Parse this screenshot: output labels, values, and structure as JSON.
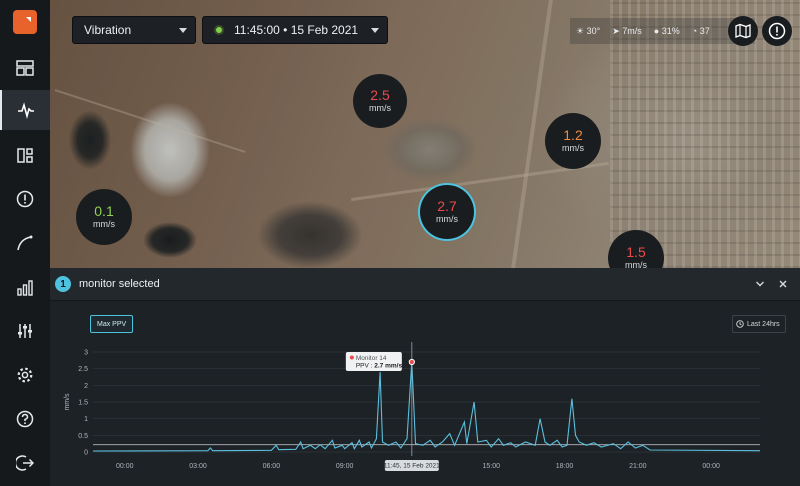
{
  "sidebar": {
    "items": [
      {
        "name": "dashboard-icon"
      },
      {
        "name": "vibration-wave-icon",
        "active": true
      },
      {
        "name": "devices-icon"
      },
      {
        "name": "alert-icon"
      },
      {
        "name": "trend-curve-icon"
      },
      {
        "name": "bar-chart-icon"
      },
      {
        "name": "sliders-icon"
      },
      {
        "name": "settings-icon"
      },
      {
        "name": "help-icon"
      },
      {
        "name": "logout-icon"
      }
    ]
  },
  "controls": {
    "metric": "Vibration",
    "datetime": "11:45:00 • 15 Feb 2021",
    "status_color": "#7fd14a"
  },
  "weather": {
    "temp": "30°",
    "wind": "7m/s",
    "humidity": "31%",
    "visibility": "37"
  },
  "sensors": [
    {
      "value": "2.5",
      "unit": "mm/s",
      "color": "#e84b4b"
    },
    {
      "value": "1.2",
      "unit": "mm/s",
      "color": "#f08a3b"
    },
    {
      "value": "0.1",
      "unit": "mm/s",
      "color": "#8fd14f"
    },
    {
      "value": "2.7",
      "unit": "mm/s",
      "color": "#e84b4b",
      "selected": true
    },
    {
      "value": "1.5",
      "unit": "mm/s",
      "color": "#e84b4b"
    }
  ],
  "panel": {
    "count": "1",
    "title": "monitor selected",
    "max_ppv_label": "Max PPV",
    "range_label": "Last 24hrs"
  },
  "chart_data": {
    "type": "line",
    "ylabel": "mm/s",
    "ylim": [
      0,
      3
    ],
    "yticks": [
      "0",
      "0.5",
      "1",
      "1.5",
      "2",
      "2.5",
      "3"
    ],
    "xticks": [
      "00:00",
      "03:00",
      "06:00",
      "09:00",
      "12:00",
      "15:00",
      "18:00",
      "21:00",
      "00:00"
    ],
    "x_hours_range": [
      -1.3,
      26
    ],
    "cursor": {
      "label": "11:45, 15 Feb 2021",
      "hour": 11.75
    },
    "tooltip": {
      "title": "Monitor 14",
      "prefix": "PPV : ",
      "value": "2.7 mm/s"
    },
    "series": [
      {
        "color": "#5bc0de",
        "points": [
          [
            -1.3,
            0.03
          ],
          [
            3.4,
            0.04
          ],
          [
            3.5,
            0.12
          ],
          [
            3.6,
            0.04
          ],
          [
            6.0,
            0.05
          ],
          [
            6.2,
            0.2
          ],
          [
            6.3,
            0.07
          ],
          [
            7.0,
            0.08
          ],
          [
            7.2,
            0.3
          ],
          [
            7.3,
            0.1
          ],
          [
            7.6,
            0.2
          ],
          [
            7.8,
            0.1
          ],
          [
            8.0,
            0.22
          ],
          [
            8.2,
            0.1
          ],
          [
            8.5,
            0.35
          ],
          [
            8.6,
            0.12
          ],
          [
            8.9,
            0.2
          ],
          [
            9.0,
            0.1
          ],
          [
            9.3,
            0.28
          ],
          [
            9.4,
            0.1
          ],
          [
            9.6,
            0.35
          ],
          [
            9.7,
            0.15
          ],
          [
            10.0,
            0.3
          ],
          [
            10.1,
            0.12
          ],
          [
            10.3,
            0.4
          ],
          [
            10.45,
            2.4
          ],
          [
            10.55,
            0.3
          ],
          [
            10.8,
            0.2
          ],
          [
            11.1,
            0.3
          ],
          [
            11.3,
            0.12
          ],
          [
            11.55,
            0.4
          ],
          [
            11.75,
            2.7
          ],
          [
            11.9,
            0.25
          ],
          [
            12.2,
            0.2
          ],
          [
            12.5,
            0.35
          ],
          [
            12.7,
            0.15
          ],
          [
            13.0,
            0.3
          ],
          [
            13.3,
            0.55
          ],
          [
            13.5,
            0.2
          ],
          [
            13.9,
            0.9
          ],
          [
            14.0,
            0.25
          ],
          [
            14.3,
            1.5
          ],
          [
            14.45,
            0.3
          ],
          [
            14.8,
            0.35
          ],
          [
            15.0,
            0.15
          ],
          [
            15.3,
            0.4
          ],
          [
            15.5,
            0.2
          ],
          [
            15.8,
            0.28
          ],
          [
            16.0,
            0.15
          ],
          [
            16.4,
            0.3
          ],
          [
            16.8,
            0.2
          ],
          [
            17.0,
            1.0
          ],
          [
            17.2,
            0.3
          ],
          [
            17.4,
            0.2
          ],
          [
            17.7,
            0.35
          ],
          [
            17.9,
            0.15
          ],
          [
            18.1,
            0.2
          ],
          [
            18.3,
            1.6
          ],
          [
            18.45,
            0.5
          ],
          [
            18.6,
            0.3
          ],
          [
            18.9,
            0.2
          ],
          [
            19.2,
            0.28
          ],
          [
            19.5,
            0.15
          ],
          [
            20.0,
            0.25
          ],
          [
            20.3,
            0.1
          ],
          [
            20.6,
            0.3
          ],
          [
            20.9,
            0.12
          ],
          [
            21.2,
            0.2
          ],
          [
            21.5,
            0.06
          ],
          [
            26.0,
            0.04
          ]
        ]
      }
    ],
    "threshold": 0.22
  }
}
